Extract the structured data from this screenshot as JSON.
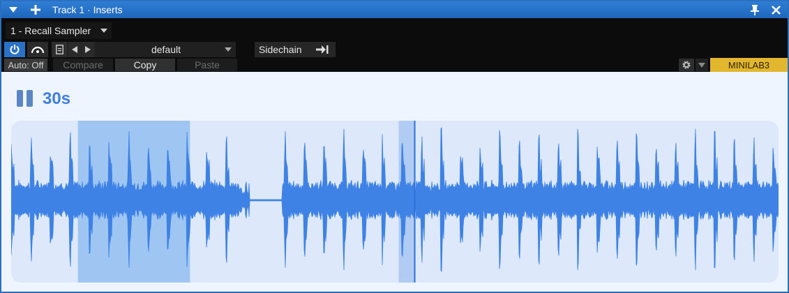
{
  "titlebar": {
    "title": "Track 1 · Inserts",
    "icons": [
      "collapse-triangle-icon",
      "plus-icon",
      "pin-icon",
      "close-icon"
    ]
  },
  "plugin": {
    "name": "1 - Recall Sampler"
  },
  "controls": {
    "preset_name": "default",
    "sidechain_label": "Sidechain",
    "auto_label": "Auto: Off",
    "compare_label": "Compare",
    "copy_label": "Copy",
    "paste_label": "Paste",
    "device_label": "MINILAB3"
  },
  "player": {
    "state": "paused",
    "time_label": "30s"
  },
  "waveform": {
    "selection_start": 0.087,
    "selection_end": 0.233,
    "playhead": 0.525,
    "silence_start": 0.31,
    "silence_end": 0.353
  },
  "colors": {
    "titlebar": "#2b6fc0",
    "power_active": "#2a72c8",
    "device_badge": "#e2b62d",
    "content_bg": "#eef5ff",
    "wave": "#3e82e6",
    "selection": "#9fc6f3",
    "time_text": "#3f7de0"
  }
}
